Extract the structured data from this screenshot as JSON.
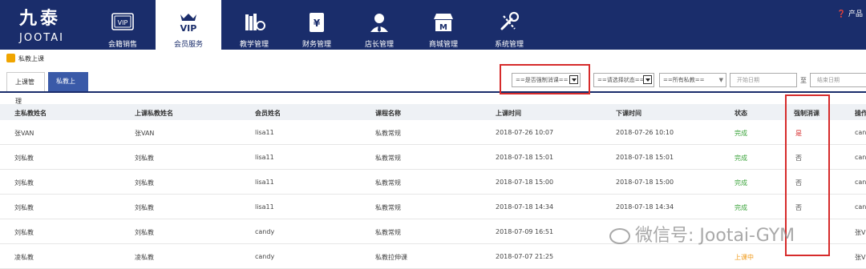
{
  "brand": {
    "cn": "九泰",
    "en": "JOOTAI"
  },
  "nav": [
    {
      "label": "会籍销售",
      "icon": "vip-card-icon"
    },
    {
      "label": "会员服务",
      "icon": "vip-crown-icon",
      "active": true
    },
    {
      "label": "教学管理",
      "icon": "books-icon"
    },
    {
      "label": "财务管理",
      "icon": "yen-document-icon"
    },
    {
      "label": "店长管理",
      "icon": "manager-icon"
    },
    {
      "label": "商城管理",
      "icon": "shop-icon"
    },
    {
      "label": "系统管理",
      "icon": "tools-icon"
    }
  ],
  "top_right": "产品",
  "breadcrumb": "私教上课",
  "tabs": [
    "上课管理",
    "私教上课"
  ],
  "filters": {
    "force_consume": "==是否强制消课==",
    "status": "==请选择状态==",
    "coach": "==所有私教==",
    "start_placeholder": "开始日期",
    "separator": "至",
    "end_placeholder": "结束日期"
  },
  "columns": [
    "主私教姓名",
    "上课私教姓名",
    "会员姓名",
    "课程名称",
    "上课时间",
    "下课时间",
    "状态",
    "强制消课",
    "操作"
  ],
  "rows": [
    [
      "张VAN",
      "张VAN",
      "lisa11",
      "私教常规",
      "2018-07-26 10:07",
      "2018-07-26 10:10",
      "完成",
      "是",
      "cand"
    ],
    [
      "刘私教",
      "刘私教",
      "lisa11",
      "私教常规",
      "2018-07-18 15:01",
      "2018-07-18 15:01",
      "完成",
      "否",
      "cand"
    ],
    [
      "刘私教",
      "刘私教",
      "lisa11",
      "私教常规",
      "2018-07-18 15:00",
      "2018-07-18 15:00",
      "完成",
      "否",
      "cand"
    ],
    [
      "刘私教",
      "刘私教",
      "lisa11",
      "私教常规",
      "2018-07-18 14:34",
      "2018-07-18 14:34",
      "完成",
      "否",
      "cand"
    ],
    [
      "刘私教",
      "刘私教",
      "candy",
      "私教常规",
      "2018-07-09 16:51",
      "",
      "",
      "",
      "张V"
    ],
    [
      "凌私教",
      "凌私教",
      "candy",
      "私教拉伸课",
      "2018-07-07 21:25",
      "",
      "上课中",
      "",
      "张V"
    ]
  ],
  "watermark": "微信号: Jootai-GYM",
  "colors": {
    "nav_bg": "#1a2d6b",
    "accent": "#3a5aa8",
    "done": "#3aa33a",
    "in_progress": "#f09a1a",
    "highlight_box": "#d62b2b"
  }
}
